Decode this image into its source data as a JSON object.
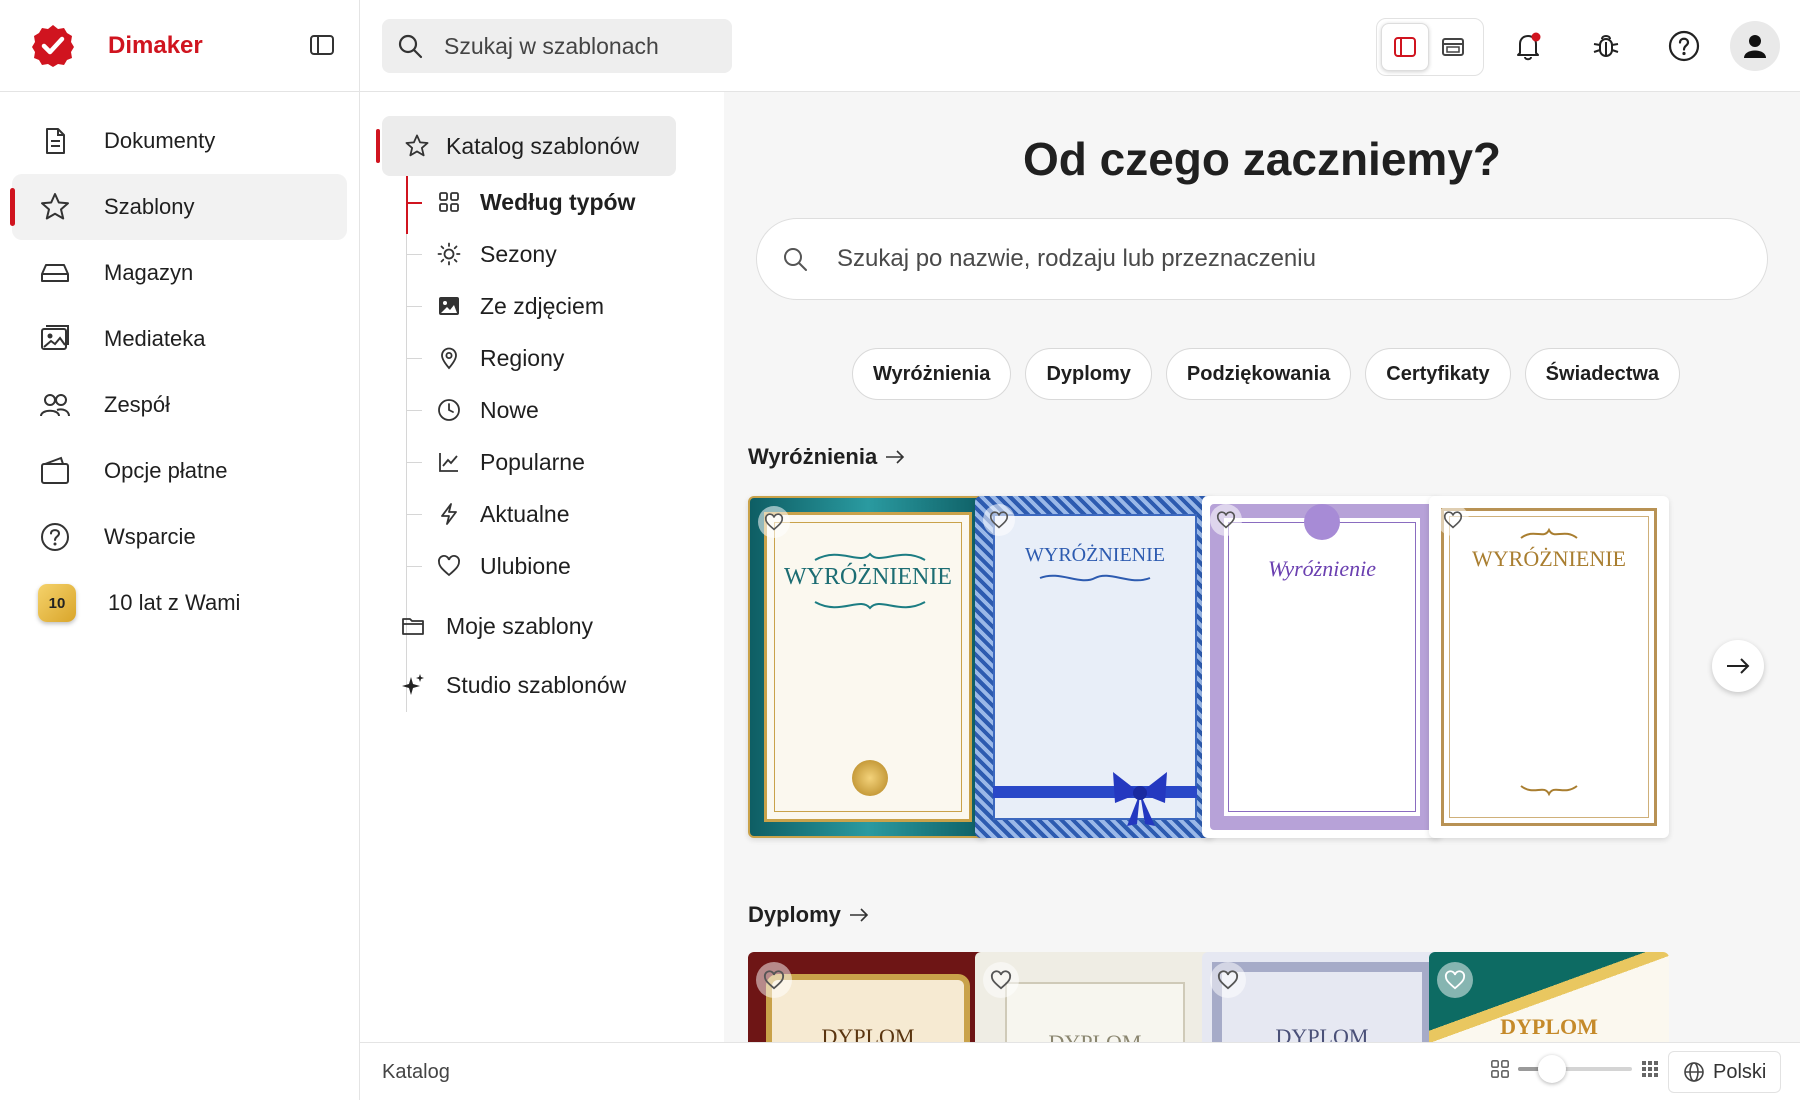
{
  "app": {
    "name": "Dimaker",
    "brand_color": "#d0141f"
  },
  "sidebar": {
    "items": [
      {
        "label": "Dokumenty",
        "icon": "document-icon"
      },
      {
        "label": "Szablony",
        "icon": "star-icon",
        "active": true
      },
      {
        "label": "Magazyn",
        "icon": "storage-drive-icon"
      },
      {
        "label": "Mediateka",
        "icon": "media-library-icon"
      },
      {
        "label": "Zespół",
        "icon": "team-icon"
      },
      {
        "label": "Opcje płatne",
        "icon": "wallet-icon"
      },
      {
        "label": "Wsparcie",
        "icon": "help-circle-icon"
      },
      {
        "label": "10 lat z Wami",
        "icon": "anniversary-badge-icon",
        "badge": "10"
      }
    ]
  },
  "topbar": {
    "search_placeholder": "Szukaj w szablonach",
    "icons": [
      "layout-sidebar-icon",
      "layout-window-icon",
      "bell-icon",
      "bug-icon",
      "help-icon",
      "user-avatar-icon"
    ]
  },
  "catalog_tree": {
    "root": "Katalog szablonów",
    "children": [
      {
        "label": "Według typów",
        "icon": "grid-icon",
        "selected": true
      },
      {
        "label": "Sezony",
        "icon": "sun-icon"
      },
      {
        "label": "Ze zdjęciem",
        "icon": "image-icon"
      },
      {
        "label": "Regiony",
        "icon": "location-pin-icon"
      },
      {
        "label": "Nowe",
        "icon": "clock-icon"
      },
      {
        "label": "Popularne",
        "icon": "trend-chart-icon"
      },
      {
        "label": "Aktualne",
        "icon": "lightning-icon"
      },
      {
        "label": "Ulubione",
        "icon": "heart-icon"
      }
    ],
    "other_roots": [
      {
        "label": "Moje szablony",
        "icon": "folder-icon"
      },
      {
        "label": "Studio szablonów",
        "icon": "sparkle-icon"
      }
    ]
  },
  "main": {
    "hero_title": "Od czego zaczniemy?",
    "search_placeholder": "Szukaj po nazwie, rodzaju lub przeznaczeniu",
    "chips": [
      "Wyróżnienia",
      "Dyplomy",
      "Podziękowania",
      "Certyfikaty",
      "Świadectwa"
    ],
    "sections": [
      {
        "title": "Wyróżnienia",
        "cards": [
          {
            "title": "WYRÓŻNIENIE",
            "style": "teal-gold"
          },
          {
            "title": "WYRÓŻNIENIE",
            "style": "blue-ribbon"
          },
          {
            "title": "Wyróżnienie",
            "style": "violet-guilloche"
          },
          {
            "title": "WYRÓŻNIENIE",
            "style": "gold-frame"
          }
        ]
      },
      {
        "title": "Dyplomy",
        "cards": [
          {
            "title": "DYPLOM",
            "style": "burgundy-baroque"
          },
          {
            "title": "DYPLOM",
            "style": "beige-floral"
          },
          {
            "title": "DYPLOM",
            "style": "lavender-ornament"
          },
          {
            "title": "DYPLOM",
            "style": "teal-gold-stripe"
          }
        ]
      }
    ]
  },
  "statusbar": {
    "breadcrumb": "Katalog",
    "zoom_level": 0.3,
    "language": "Polski"
  }
}
